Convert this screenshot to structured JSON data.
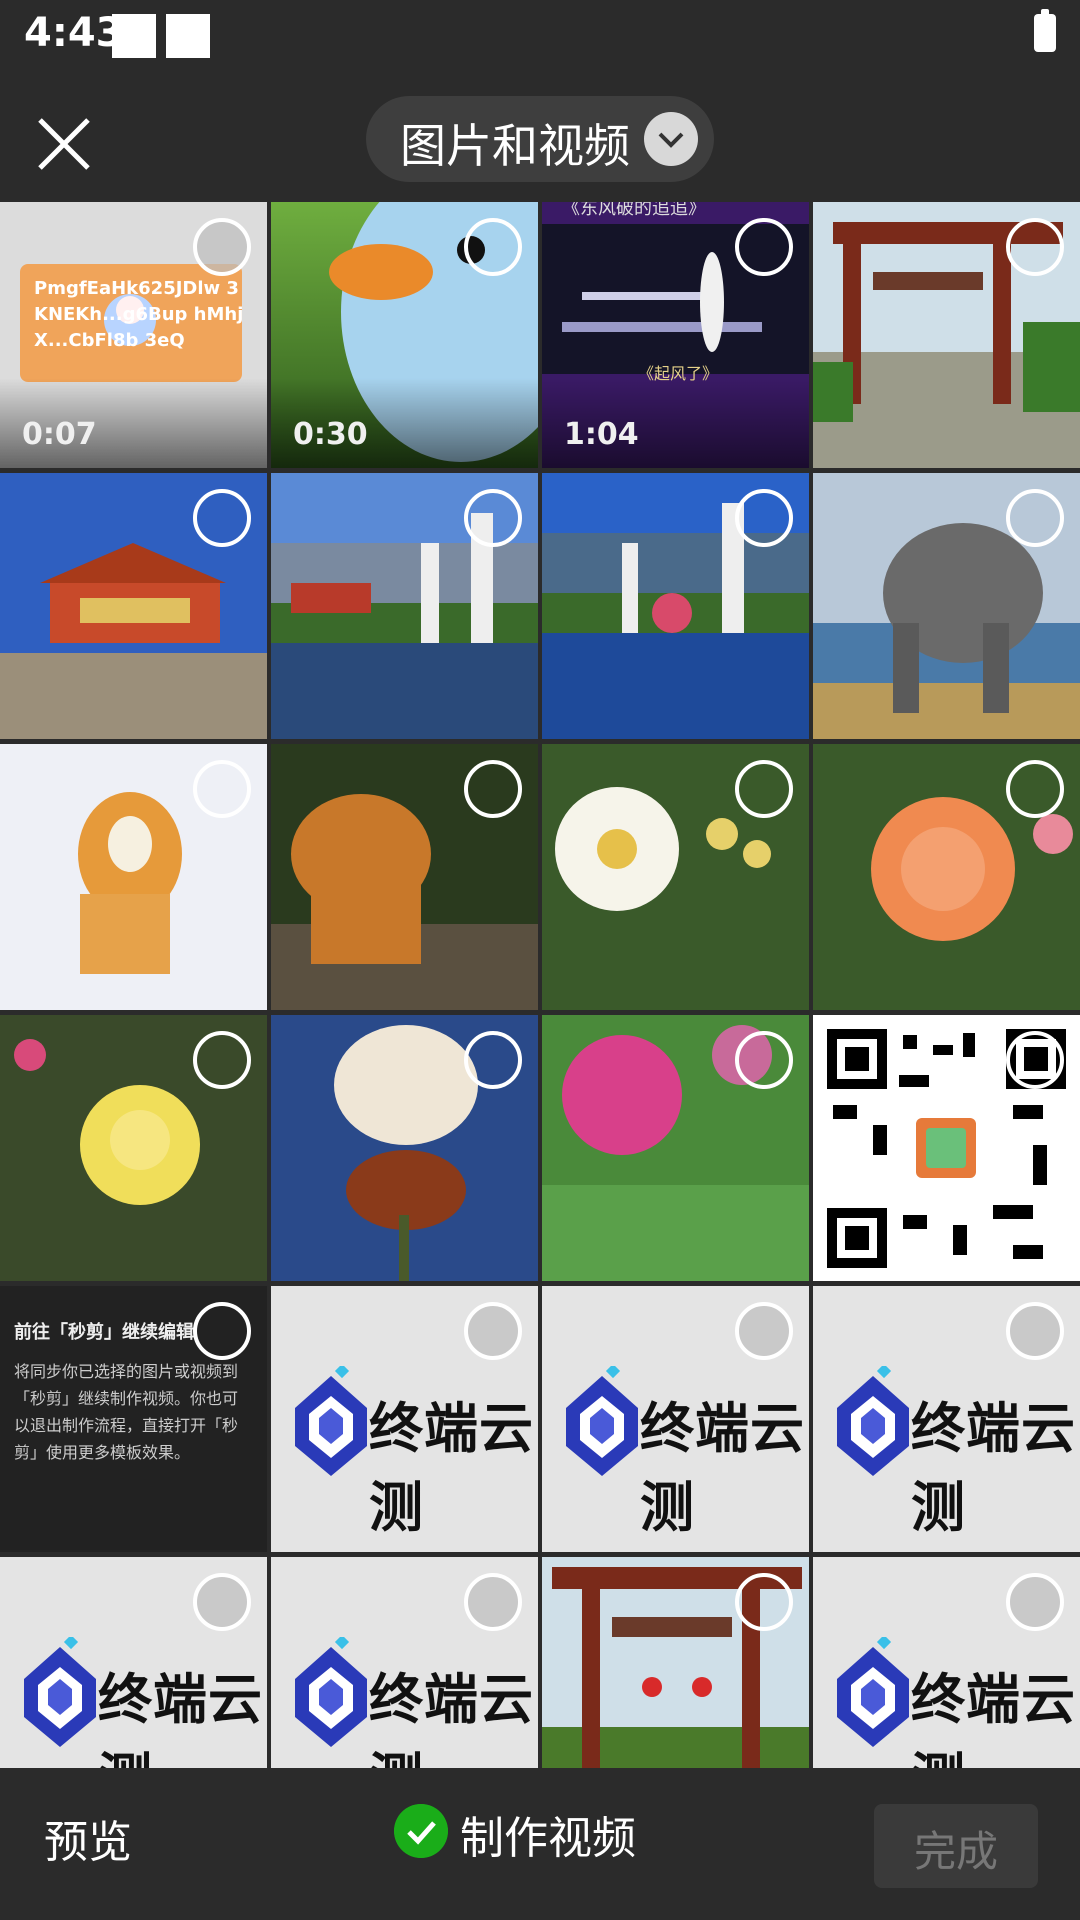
{
  "status_bar": {
    "time": "4:43"
  },
  "header": {
    "album_label": "图片和视频"
  },
  "grid": {
    "video_durations": [
      "0:07",
      "0:30",
      "1:04"
    ],
    "tile_text": {
      "code_text": "PmgfEaHk625JDlw 3KNEKh...g6Bup hMhjX...CbFl8b 3eQ",
      "concert_caption": "《起风了》",
      "concert_title": "《东风破的追追》"
    },
    "tip": {
      "title": "前往「秒剪」继续编辑",
      "body": "将同步你已选择的图片或视频到「秒剪」继续制作视频。你也可以退出制作流程，直接打开「秒剪」使用更多模板效果。"
    },
    "logo_text": "终端云测"
  },
  "footer": {
    "preview_label": "预览",
    "make_video_label": "制作视频",
    "done_label": "完成"
  },
  "colors": {
    "accent_green": "#1aad19",
    "background": "#2b2b2b"
  }
}
